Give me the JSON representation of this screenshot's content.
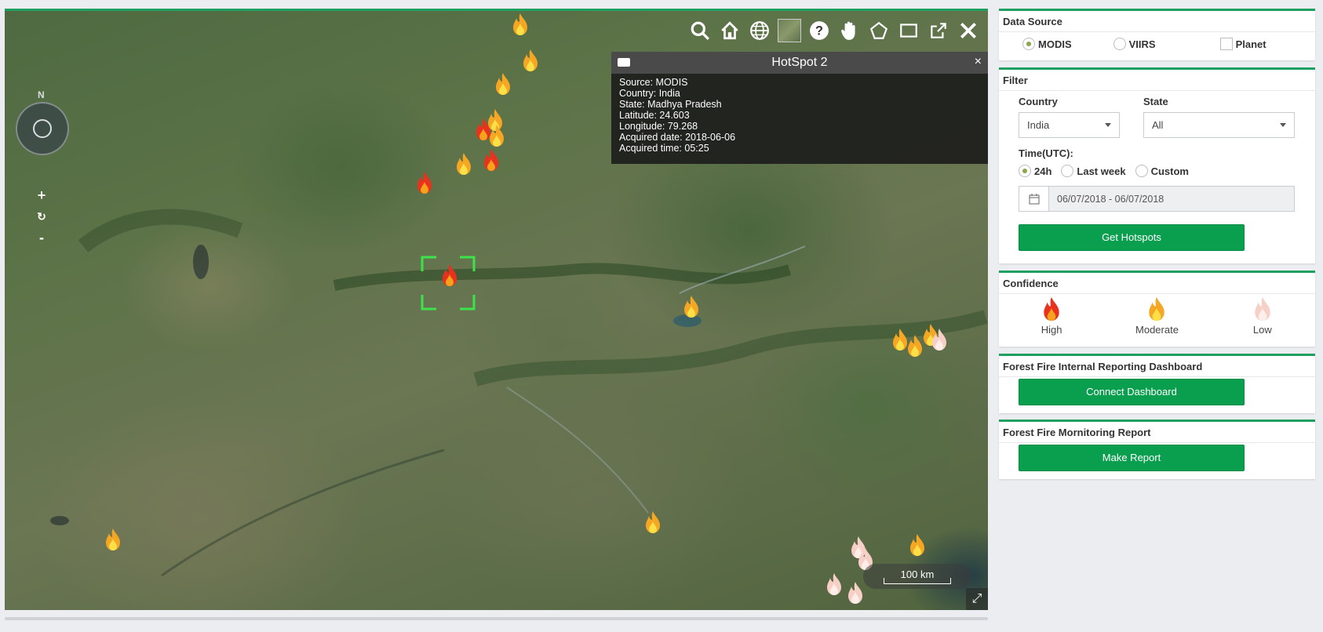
{
  "map": {
    "toolbar": [
      {
        "icon": "search-icon"
      },
      {
        "icon": "home-icon"
      },
      {
        "icon": "globe-icon"
      },
      {
        "icon": "basemap-thumbnail"
      },
      {
        "icon": "help-icon"
      },
      {
        "icon": "pan-hand-icon"
      },
      {
        "icon": "polygon-icon"
      },
      {
        "icon": "rectangle-icon"
      },
      {
        "icon": "share-icon"
      },
      {
        "icon": "close-icon"
      }
    ],
    "compass_label": "N",
    "zoom": {
      "in": "+",
      "reset": "↻",
      "out": "-"
    },
    "scale_label": "100 km",
    "popup": {
      "title": "HotSpot 2",
      "close": "×",
      "lines": [
        "Source: MODIS",
        "Country: India",
        "State: Madhya Pradesh",
        "Latitude: 24.603",
        "Longitude: 79.268",
        "Acquired date: 2018-06-06",
        "Acquired time: 05:25"
      ]
    }
  },
  "panels": {
    "data_source": {
      "title": "Data Source",
      "options": [
        "MODIS",
        "VIIRS",
        "Planet"
      ],
      "selected": "MODIS"
    },
    "filter": {
      "title": "Filter",
      "country_label": "Country",
      "country_value": "India",
      "state_label": "State",
      "state_value": "All",
      "time_label": "Time(UTC):",
      "time_options": [
        "24h",
        "Last week",
        "Custom"
      ],
      "time_selected": "24h",
      "date_range": "06/07/2018 - 06/07/2018",
      "button": "Get Hotspots"
    },
    "confidence": {
      "title": "Confidence",
      "levels": [
        "High",
        "Moderate",
        "Low"
      ]
    },
    "dashboard": {
      "title": "Forest Fire Internal Reporting Dashboard",
      "button": "Connect Dashboard"
    },
    "report": {
      "title": "Forest Fire Mornitoring Report",
      "button": "Make Report"
    }
  },
  "colors": {
    "accent": "#1fa060",
    "button": "#0a9e4f",
    "fire_high": "#e8321e",
    "fire_moderate": "#f5a623",
    "fire_low": "#f6d6cf",
    "selection": "#3de34a"
  },
  "hotspots": [
    {
      "confidence": "moderate"
    },
    {
      "confidence": "moderate"
    },
    {
      "confidence": "moderate"
    },
    {
      "confidence": "moderate"
    },
    {
      "confidence": "high"
    },
    {
      "confidence": "moderate"
    },
    {
      "confidence": "moderate"
    },
    {
      "confidence": "high"
    },
    {
      "confidence": "high"
    },
    {
      "confidence": "high"
    },
    {
      "confidence": "moderate"
    },
    {
      "confidence": "moderate"
    },
    {
      "confidence": "moderate"
    },
    {
      "confidence": "moderate"
    },
    {
      "confidence": "low"
    },
    {
      "confidence": "moderate"
    },
    {
      "confidence": "moderate"
    },
    {
      "confidence": "moderate"
    },
    {
      "confidence": "low"
    },
    {
      "confidence": "low"
    },
    {
      "confidence": "low"
    },
    {
      "confidence": "low"
    }
  ]
}
